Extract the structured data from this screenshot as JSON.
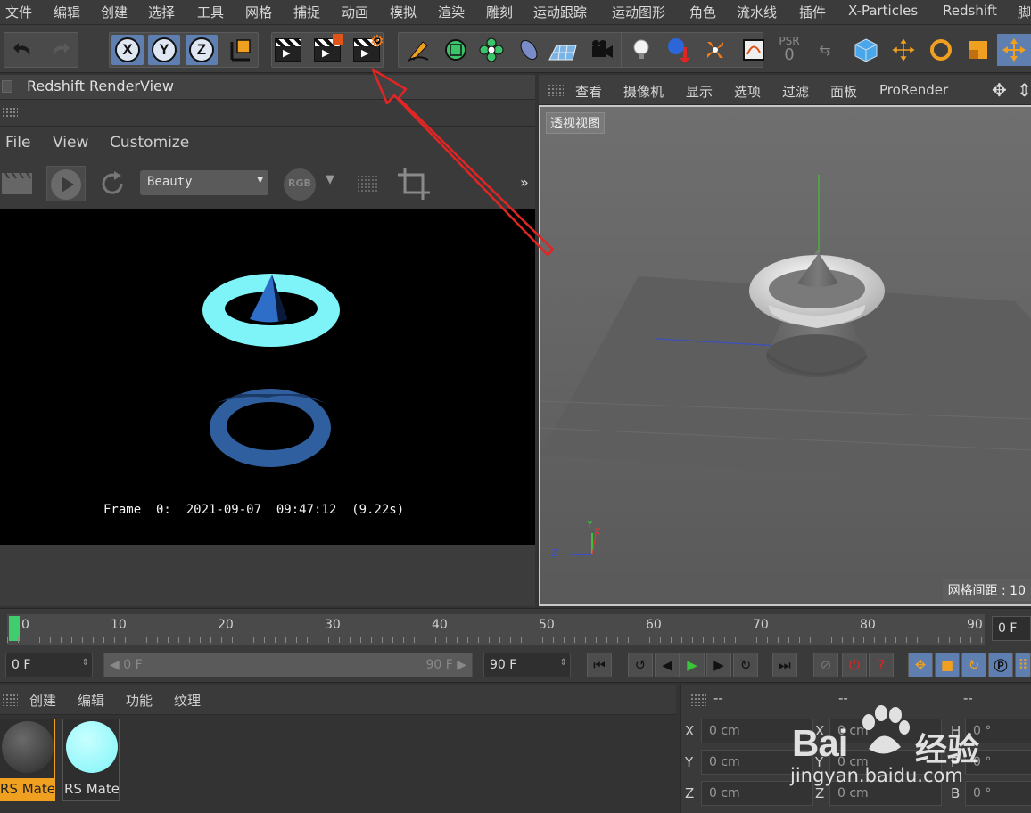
{
  "menubar": {
    "items": [
      "文件",
      "编辑",
      "创建",
      "选择",
      "工具",
      "网格",
      "捕捉",
      "动画",
      "模拟",
      "渲染",
      "雕刻",
      "运动跟踪",
      "运动图形",
      "角色",
      "流水线",
      "插件",
      "X-Particles",
      "Redshift",
      "脚"
    ]
  },
  "toolbar": {
    "axis_x": "X",
    "axis_y": "Y",
    "axis_z": "Z",
    "psr_label": "PSR",
    "psr_value": "0"
  },
  "redshift": {
    "title": "Redshift RenderView",
    "menu": [
      "File",
      "View",
      "Customize"
    ],
    "aov_select": "Beauty",
    "rgb_label": "RGB",
    "overflow": "»",
    "frame_info": "Frame  0:  2021-09-07  09:47:12  (9.22s)"
  },
  "viewport": {
    "menu": [
      "查看",
      "摄像机",
      "显示",
      "选项",
      "过滤",
      "面板",
      "ProRender"
    ],
    "label": "透视视图",
    "grid_spacing": "网格间距 : 10",
    "axis_y": "Y",
    "axis_x": "X",
    "axis_z": "Z"
  },
  "timeline": {
    "ticks": [
      "0",
      "10",
      "20",
      "30",
      "40",
      "50",
      "60",
      "70",
      "80",
      "90"
    ],
    "current_frame": "0 F"
  },
  "transport": {
    "start": "0 F",
    "range_start": "0 F",
    "range_end": "90 F",
    "end": "90 F"
  },
  "materials": {
    "menu": [
      "创建",
      "编辑",
      "功能",
      "纹理"
    ],
    "items": [
      {
        "name": "RS Material",
        "color": "#4a4a4a",
        "selected": true
      },
      {
        "name": "RS Material",
        "color": "#7ff4f8",
        "selected": false
      }
    ]
  },
  "coordinates": {
    "head": [
      "--",
      "--",
      "--"
    ],
    "rows": [
      {
        "axis": "X",
        "pos": "0 cm",
        "axis2": "X",
        "size": "0 cm",
        "rot_axis": "H",
        "rot": "0 °"
      },
      {
        "axis": "Y",
        "pos": "0 cm",
        "axis2": "Y",
        "size": "0 cm",
        "rot_axis": "P",
        "rot": "0 °"
      },
      {
        "axis": "Z",
        "pos": "0 cm",
        "axis2": "Z",
        "size": "0 cm",
        "rot_axis": "B",
        "rot": "0 °"
      }
    ]
  },
  "watermark": {
    "brand": "Bai",
    "brand2": "经验",
    "url": "jingyan.baidu.com"
  },
  "colors": {
    "accent_blue": "#5e7fb0",
    "timeline_cursor": "#3fce6b",
    "render_cyan": "#7ff4f8",
    "render_blue": "#3a6fb5",
    "annotation_red": "#e02525",
    "selected_material": "#f0a020"
  }
}
